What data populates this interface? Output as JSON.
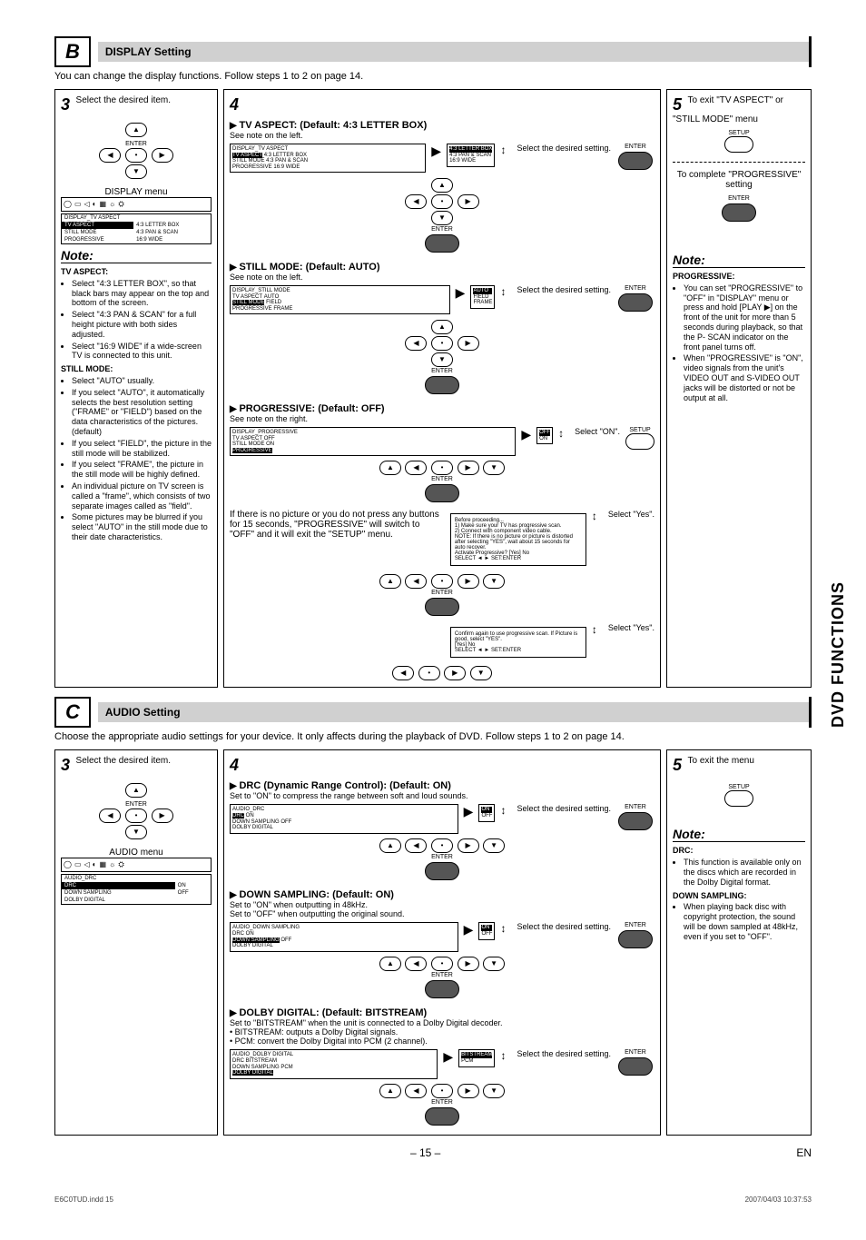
{
  "sideTab": "DVD FUNCTIONS",
  "page": {
    "num": "– 15 –",
    "lang": "EN",
    "indd": "E6C0TUD.indd   15",
    "date": "2007/04/03   10:37:53"
  },
  "B": {
    "letter": "B",
    "title": "DISPLAY Setting",
    "intro": "You can change the display functions. Follow steps 1 to 2 on page 14.",
    "step3": {
      "num": "3",
      "text": "Select the desired item.",
      "menuLabel": "DISPLAY menu",
      "menu": {
        "header": "DISPLAY_TV ASPECT",
        "rows": [
          [
            "TV ASPECT",
            "4:3 LETTER BOX"
          ],
          [
            "STILL MODE",
            "4:3 PAN & SCAN"
          ],
          [
            "PROGRESSIVE",
            "16:9 WIDE"
          ]
        ]
      }
    },
    "step4": {
      "num": "4",
      "tvAspect": {
        "heading": "TV ASPECT: (Default: 4:3 LETTER BOX)",
        "sub": "See note on the left.",
        "select": "Select the desired setting.",
        "enter": "ENTER",
        "menu": {
          "header": "DISPLAY_TV ASPECT",
          "left": [
            [
              "TV ASPECT",
              "4:3 LETTER BOX"
            ],
            [
              "STILL MODE",
              "4:3 PAN & SCAN"
            ],
            [
              "PROGRESSIVE",
              "16:9 WIDE"
            ]
          ],
          "right": [
            [
              "4:3 LETTER BOX"
            ],
            [
              "4:3 PAN & SCAN"
            ],
            [
              "16:9 WIDE"
            ]
          ]
        }
      },
      "stillMode": {
        "heading": "STILL MODE: (Default: AUTO)",
        "sub": "See note on the left.",
        "select": "Select the desired setting.",
        "enter": "ENTER",
        "menu": {
          "header": "DISPLAY_STILL MODE",
          "left": [
            [
              "TV ASPECT",
              "AUTO"
            ],
            [
              "STILL MODE",
              "FIELD"
            ],
            [
              "PROGRESSIVE",
              "FRAME"
            ]
          ],
          "right": [
            [
              "AUTO"
            ],
            [
              "FIELD"
            ],
            [
              "FRAME"
            ]
          ]
        }
      },
      "progressive": {
        "heading": "PROGRESSIVE: (Default: OFF)",
        "sub": "See note on the right.",
        "menu": {
          "header": "DISPLAY_PROGRESSIVE",
          "rows": [
            [
              "TV ASPECT",
              "OFF"
            ],
            [
              "STILL MODE",
              "ON"
            ],
            [
              "PROGRESSIVE",
              ""
            ]
          ],
          "right": [
            [
              "OFF"
            ],
            [
              "ON"
            ]
          ]
        },
        "noPic": "If there is no picture or you do not press any buttons for 15 seconds, \"PROGRESSIVE\" will switch to \"OFF\" and it will exit the \"SETUP\" menu.",
        "flow1": "Select \"ON\".",
        "flow2": "Select \"Yes\".",
        "flow3": "Select \"Yes\".",
        "setup": "SETUP",
        "enter": "ENTER",
        "warn1": "Before proceeding...\n1) Make sure your TV has progressive scan.\n2) Connect with component video cable.\nNOTE: If there is no picture or picture is distorted after selecting \"YES\", wait about 15 seconds for auto recover.",
        "warn1btn": "Activate Progressive?     [Yes]  No",
        "warn2": "Confirm again to use progressive scan. If Picture is good, select \"YES\".",
        "warn2btn": "[Yes]   No",
        "footer": "SELECT ◄ ►     SET:ENTER"
      }
    },
    "step5": {
      "num": "5",
      "exit1": "To exit \"TV ASPECT\" or \"STILL MODE\" menu",
      "setup": "SETUP",
      "divider": true,
      "exit2": "To complete \"PROGRESSIVE\" setting",
      "enter": "ENTER"
    },
    "note3": {
      "heading": "Note:",
      "tvAspect": "TV ASPECT:",
      "tvItems": [
        "Select \"4:3 LETTER BOX\", so that black bars may appear on the top and bottom of the screen.",
        "Select \"4:3 PAN & SCAN\" for a full height picture with both sides adjusted.",
        "Select \"16:9 WIDE\" if a wide-screen TV is connected to this unit."
      ],
      "stillMode": "STILL MODE:",
      "stillItems": [
        "Select \"AUTO\" usually.",
        "If you select \"AUTO\", it automatically selects the best resolution setting (\"FRAME\" or \"FIELD\") based on the data characteristics of the pictures. (default)",
        "If you select \"FIELD\", the picture in the still mode will be stabilized.",
        "If you select \"FRAME\", the picture in the still mode will be highly defined.",
        "An individual picture on TV screen is called a \"frame\", which consists of two separate images called as \"field\".",
        "Some pictures may be blurred if you select \"AUTO\" in the still mode due to their date characteristics."
      ]
    },
    "note5": {
      "heading": "Note:",
      "prog": "PROGRESSIVE:",
      "items": [
        "You can set \"PROGRESSIVE\" to \"OFF\" in \"DISPLAY\" menu or press and hold [PLAY ▶] on the front of the unit for more than 5 seconds during playback, so that the P- SCAN indicator on the front panel turns off.",
        "When \"PROGRESSIVE\" is \"ON\", video signals from the unit's VIDEO OUT and S-VIDEO OUT jacks will be distorted or not be output at all."
      ]
    }
  },
  "C": {
    "letter": "C",
    "title": "AUDIO Setting",
    "intro": "Choose the appropriate audio settings for your device. It only affects during the playback of DVD. Follow steps 1 to 2 on page 14.",
    "step3": {
      "num": "3",
      "text": "Select the desired item.",
      "menuLabel": "AUDIO menu",
      "menu": {
        "header": "AUDIO_DRC",
        "rows": [
          [
            "DRC",
            "ON"
          ],
          [
            "DOWN SAMPLING",
            "OFF"
          ],
          [
            "DOLBY DIGITAL",
            ""
          ]
        ]
      }
    },
    "step4": {
      "num": "4",
      "drc": {
        "heading": "DRC (Dynamic Range Control): (Default: ON)",
        "sub": "Set to \"ON\" to compress the range between soft and loud sounds.",
        "select": "Select the desired setting.",
        "enter": "ENTER",
        "menu": {
          "header": "AUDIO_DRC",
          "left": [
            [
              "DRC",
              "ON"
            ],
            [
              "DOWN SAMPLING",
              "OFF"
            ],
            [
              "DOLBY DIGITAL",
              ""
            ]
          ],
          "right": [
            [
              "ON"
            ],
            [
              "OFF"
            ]
          ]
        }
      },
      "down": {
        "heading": "DOWN SAMPLING: (Default: ON)",
        "sub1": "Set to \"ON\" when outputting in 48kHz.",
        "sub2": "Set to \"OFF\" when outputting the original sound.",
        "select": "Select the desired setting.",
        "enter": "ENTER",
        "menu": {
          "header": "AUDIO_DOWN SAMPLING",
          "left": [
            [
              "DRC",
              "ON"
            ],
            [
              "DOWN SAMPLING",
              "OFF"
            ],
            [
              "DOLBY DIGITAL",
              ""
            ]
          ],
          "right": [
            [
              "ON"
            ],
            [
              "OFF"
            ]
          ]
        }
      },
      "dolby": {
        "heading": "DOLBY DIGITAL: (Default: BITSTREAM)",
        "sub": "Set to \"BITSTREAM\" when the unit is connected to a Dolby Digital decoder.",
        "b1": "• BITSTREAM: outputs a Dolby Digital signals.",
        "b2": "• PCM: convert the Dolby Digital into PCM (2 channel).",
        "select": "Select the desired setting.",
        "enter": "ENTER",
        "menu": {
          "header": "AUDIO_DOLBY DIGITAL",
          "left": [
            [
              "DRC",
              "BITSTREAM"
            ],
            [
              "DOWN SAMPLING",
              "PCM"
            ],
            [
              "DOLBY DIGITAL",
              ""
            ]
          ],
          "right": [
            [
              "BITSTREAM"
            ],
            [
              "PCM"
            ]
          ]
        }
      }
    },
    "step5": {
      "num": "5",
      "text": "To exit the menu",
      "setup": "SETUP"
    },
    "note5": {
      "heading": "Note:",
      "drc": "DRC:",
      "drcItems": [
        "This function is available only on the discs which are recorded in the Dolby Digital format."
      ],
      "down": "DOWN SAMPLING:",
      "downItems": [
        "When playing back disc with copyright protection, the sound will be down sampled at 48kHz, even if you set to \"OFF\"."
      ]
    }
  }
}
